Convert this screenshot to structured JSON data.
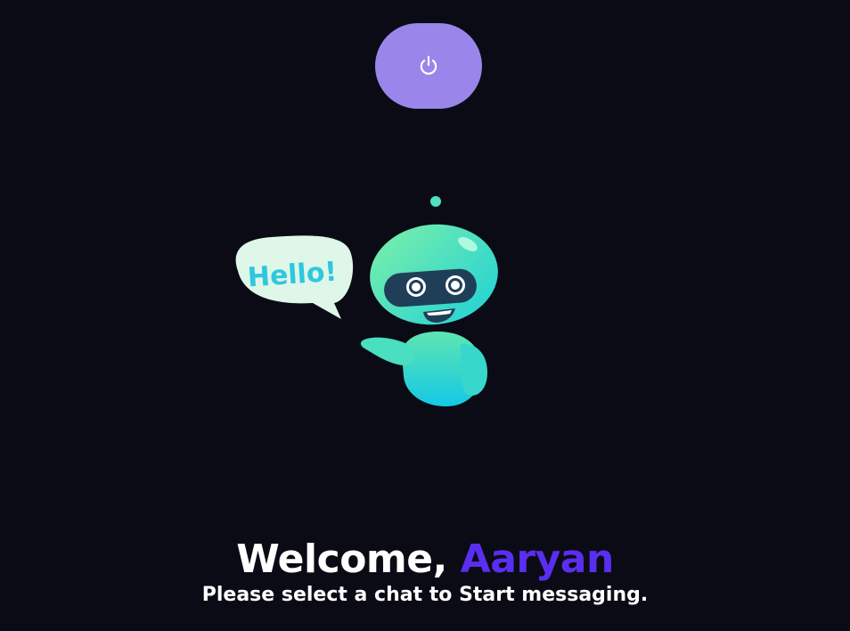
{
  "logout_button": {
    "icon": "power-icon"
  },
  "illustration": {
    "speech_bubble_text": "Hello!"
  },
  "welcome": {
    "greeting": "Welcome, ",
    "user_name": "Aaryan",
    "subtitle": "Please select a chat to Start messaging."
  },
  "colors": {
    "background": "#0b0b16",
    "button": "#9a86ea",
    "accent": "#5a2ef0"
  }
}
